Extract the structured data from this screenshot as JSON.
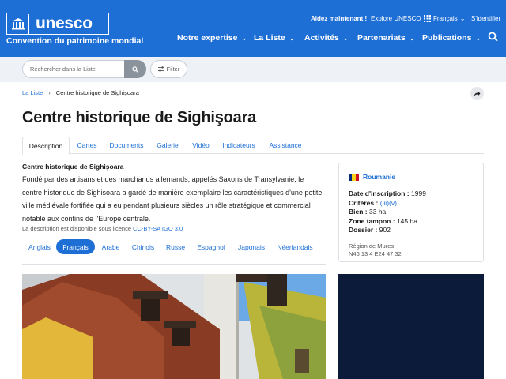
{
  "header": {
    "logo_text": "unesco",
    "subtitle": "Convention du patrimoine mondial",
    "donate": "Aidez maintenant !",
    "explore": "Explore UNESCO",
    "language": "Français",
    "login": "S'identifier",
    "nav": [
      "Notre expertise",
      "La Liste",
      "Activités",
      "Partenariats",
      "Publications"
    ]
  },
  "search": {
    "placeholder": "Rechercher dans la Liste",
    "filter_label": "Filter"
  },
  "breadcrumb": {
    "root": "La Liste",
    "current": "Centre historique de Sighişoara"
  },
  "page_title": "Centre historique de Sighişoara",
  "tabs": [
    "Description",
    "Cartes",
    "Documents",
    "Galerie",
    "Vidéo",
    "Indicateurs",
    "Assistance"
  ],
  "description": {
    "title": "Centre historique de Sighişoara",
    "text": "Fondé par des artisans et des marchands allemands, appelés Saxons de Transylvanie, le centre historique de Sighisoara a gardé de manière exemplaire les caractéristiques d'une petite ville médiévale fortifiée qui a eu pendant plusieurs siècles un rôle stratégique et commercial notable aux confins de l'Europe centrale.",
    "license_prefix": "La description est disponible sous licence",
    "license_link": "CC-BY-SA IGO 3.0"
  },
  "languages": [
    "Anglais",
    "Français",
    "Arabe",
    "Chinois",
    "Russe",
    "Espagnol",
    "Japonais",
    "Néerlandais"
  ],
  "info": {
    "country": "Roumanie",
    "date_label": "Date d'inscription :",
    "date_value": "1999",
    "criteria_label": "Critères :",
    "criteria_value": "(iii)(v)",
    "bien_label": "Bien :",
    "bien_value": "33 ha",
    "buffer_label": "Zone tampon :",
    "buffer_value": "145 ha",
    "dossier_label": "Dossier :",
    "dossier_value": "902",
    "region": "Région de Mures",
    "coords": "N46 13 4 E24 47 32"
  },
  "colors": {
    "brand_blue": "#1d6fd6",
    "map_dark": "#0c1b3a"
  }
}
